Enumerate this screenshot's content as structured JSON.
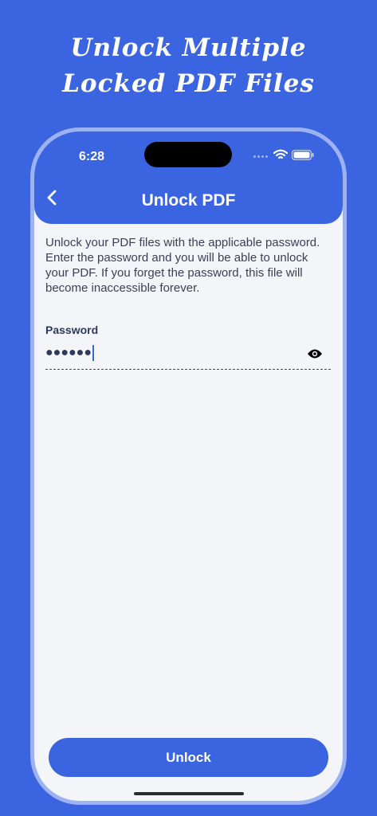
{
  "promo": {
    "headline_line1": "Unlock Multiple",
    "headline_line2": "Locked PDF Files"
  },
  "status_bar": {
    "time": "6:28"
  },
  "header": {
    "title": "Unlock PDF",
    "back_icon": "chevron-left-icon"
  },
  "content": {
    "description": "Unlock your PDF files with the applicable password. Enter the password and you will be able to unlock your PDF. If you forget the password, this file will become inaccessible forever.",
    "password_label": "Password",
    "password_value": "●●●●●●",
    "visibility_icon": "eye-icon"
  },
  "footer": {
    "unlock_label": "Unlock"
  },
  "colors": {
    "accent": "#3a64e0",
    "background": "#f4f5f8",
    "frame": "#9db2f2"
  }
}
